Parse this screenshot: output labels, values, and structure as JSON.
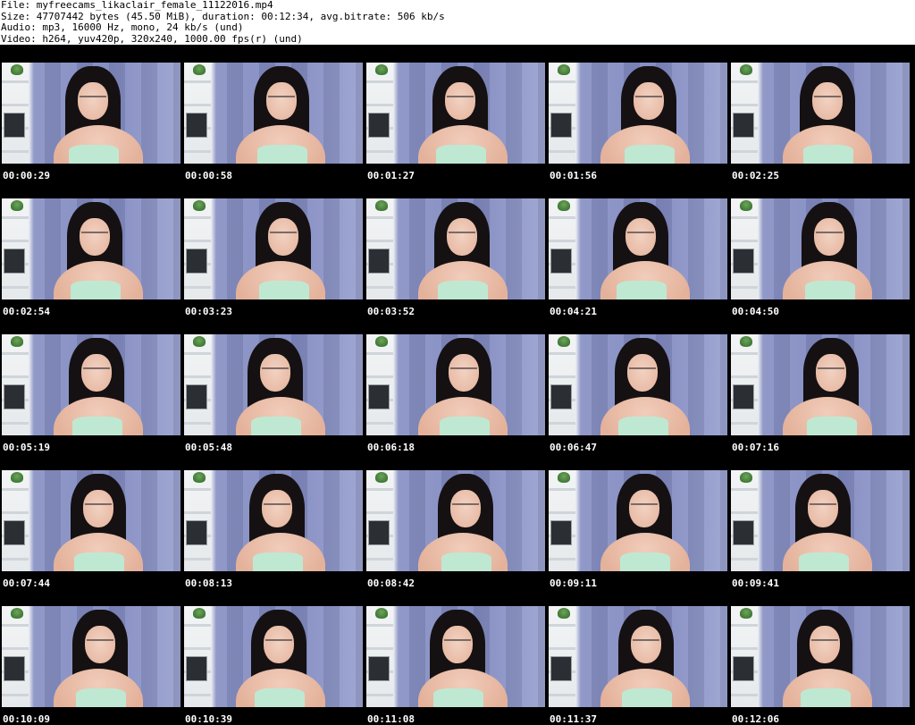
{
  "header": {
    "file_line": "File: myfreecams_likaclair_female_11122016.mp4",
    "size_line": "Size: 47707442 bytes (45.50 MiB), duration: 00:12:34, avg.bitrate: 506 kb/s",
    "audio_line": "Audio: mp3, 16000 Hz, mono, 24 kb/s (und)",
    "video_line": "Video: h264, yuv420p, 320x240, 1000.00 fps(r) (und)"
  },
  "thumbnails": [
    {
      "timestamp": "00:00:29"
    },
    {
      "timestamp": "00:00:58"
    },
    {
      "timestamp": "00:01:27"
    },
    {
      "timestamp": "00:01:56"
    },
    {
      "timestamp": "00:02:25"
    },
    {
      "timestamp": "00:02:54"
    },
    {
      "timestamp": "00:03:23"
    },
    {
      "timestamp": "00:03:52"
    },
    {
      "timestamp": "00:04:21"
    },
    {
      "timestamp": "00:04:50"
    },
    {
      "timestamp": "00:05:19"
    },
    {
      "timestamp": "00:05:48"
    },
    {
      "timestamp": "00:06:18"
    },
    {
      "timestamp": "00:06:47"
    },
    {
      "timestamp": "00:07:16"
    },
    {
      "timestamp": "00:07:44"
    },
    {
      "timestamp": "00:08:13"
    },
    {
      "timestamp": "00:08:42"
    },
    {
      "timestamp": "00:09:11"
    },
    {
      "timestamp": "00:09:41"
    },
    {
      "timestamp": "00:10:09"
    },
    {
      "timestamp": "00:10:39"
    },
    {
      "timestamp": "00:11:08"
    },
    {
      "timestamp": "00:11:37"
    },
    {
      "timestamp": "00:12:06"
    }
  ],
  "colors": {
    "sheet_background": "#000000",
    "timestamp_text": "#ffffff",
    "header_text": "#000000"
  }
}
